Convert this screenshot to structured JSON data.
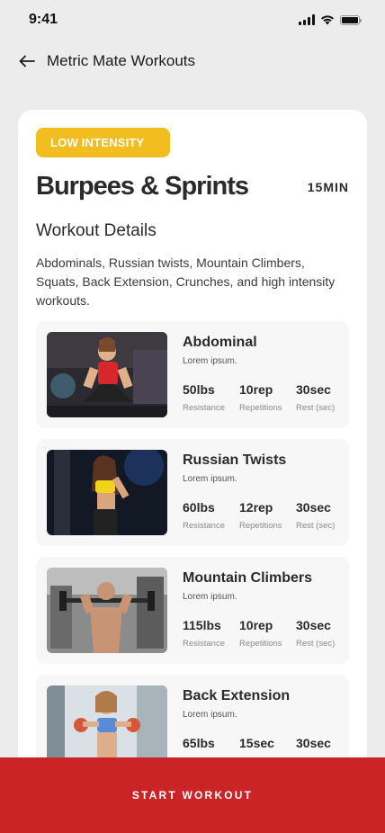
{
  "status_bar": {
    "time": "9:41"
  },
  "nav": {
    "title": "Metric Mate Workouts",
    "back_icon": "arrow-left-icon"
  },
  "workout": {
    "badge": "LOW INTENSITY",
    "title": "Burpees & Sprints",
    "duration": "15MIN",
    "section_title": "Workout Details",
    "description": "Abdominals, Russian twists, Mountain Climbers, Squats, Back Extension, Crunches, and high intensity workouts."
  },
  "exercises": [
    {
      "name": "Abdominal",
      "sub": "Lorem ipsum.",
      "resistance": "50lbs",
      "repetitions": "10rep",
      "rest": "30sec"
    },
    {
      "name": "Russian Twists",
      "sub": "Lorem ipsum.",
      "resistance": "60lbs",
      "repetitions": "12rep",
      "rest": "30sec"
    },
    {
      "name": "Mountain Climbers",
      "sub": "Lorem ipsum.",
      "resistance": "115lbs",
      "repetitions": "10rep",
      "rest": "30sec"
    },
    {
      "name": "Back Extension",
      "sub": "Lorem ipsum.",
      "resistance": "65lbs",
      "repetitions": "15sec",
      "rest": "30sec"
    }
  ],
  "stat_labels": {
    "resistance": "Resistance",
    "repetitions": "Repetitions",
    "rest": "Rest (sec)"
  },
  "cta": {
    "label": "START WORKOUT"
  },
  "colors": {
    "badge": "#f1bd1f",
    "cta": "#ca2427",
    "background": "#ececec",
    "card": "#ffffff"
  }
}
